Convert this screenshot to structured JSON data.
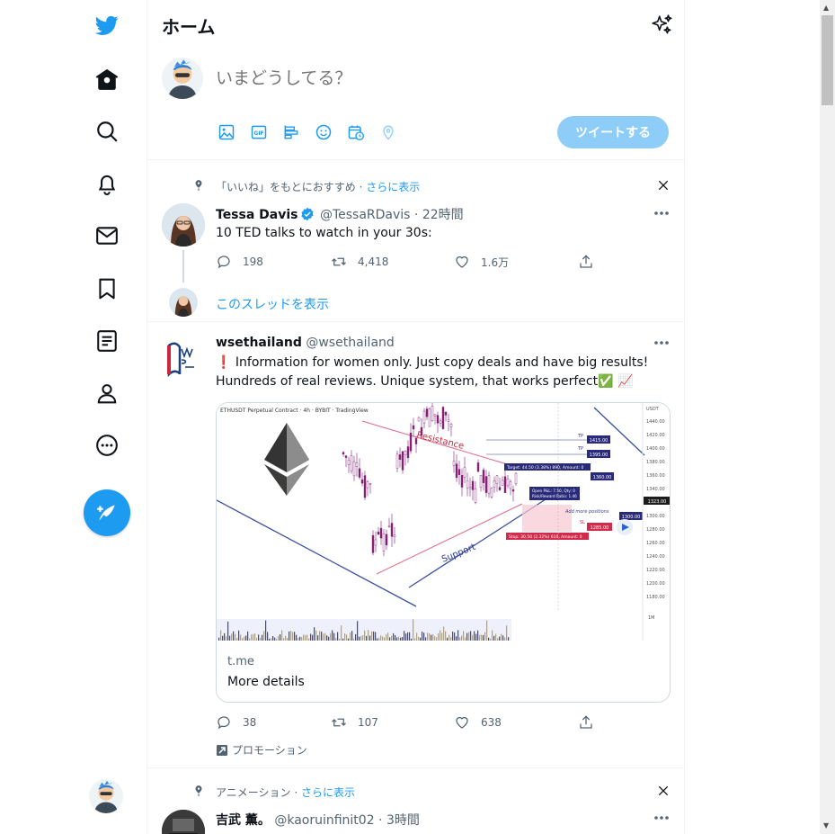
{
  "nav": {
    "icons": [
      "twitter-logo",
      "home-icon",
      "search-icon",
      "bell-icon",
      "mail-icon",
      "bookmark-icon",
      "list-icon",
      "profile-icon",
      "more-circle-icon"
    ],
    "compose_icon": "compose-icon"
  },
  "header": {
    "title": "ホーム",
    "icon": "sparkle-icon"
  },
  "composer": {
    "placeholder": "いまどうしてる？",
    "tools": [
      "image-icon",
      "gif-icon",
      "poll-icon",
      "emoji-icon",
      "schedule-icon",
      "location-icon"
    ],
    "submit_label": "ツイートする"
  },
  "feed": [
    {
      "context": "「いいね」をもとにおすすめ · ",
      "context_more": "さらに表示",
      "name": "Tessa Davis",
      "verified": true,
      "handle": "@TessaRDavis · 22時間",
      "text": "10 TED talks to watch in your 30s:",
      "replies": "198",
      "retweets": "4,418",
      "likes": "1.6万",
      "thread_link": "このスレッドを表示"
    },
    {
      "name": "wsethailand",
      "handle": "@wsethailand",
      "text_line1": "❗ Information for women only. Just copy deals and have big results!",
      "text_line2": "Hundreds of real reviews. Unique system, that works perfect✅ 📈",
      "card": {
        "chart_header": "ETHUSDT Perpetual Contract · 4h · BYBIT · TradingView",
        "resistance": "Resistance",
        "support": "Support",
        "add_positions": "Add more positions",
        "tp": "TP",
        "sl": "SL",
        "price_tags": [
          "1415.00",
          "1395.00",
          "1360.00",
          "1323.00",
          "1300.00",
          "1285.00"
        ],
        "target_label": "Target: 44.50 (3.38%) 890, Amount: 0",
        "open_pnl_label": "Open P&L: 7.50, Qty: 0",
        "risk_reward_label": "Risk/Reward Ratio: 1.46",
        "stop_label": "Stop: 30.50 (2.32%) 610, Amount: 0",
        "axis_ticks": [
          "1440.00",
          "1420.00",
          "1400.00",
          "1380.00",
          "1360.00",
          "1340.00",
          "1320.00",
          "1300.00",
          "1280.00",
          "1260.00",
          "1240.00",
          "1220.00",
          "1200.00",
          "1180.00"
        ],
        "axis_unit": "USDT",
        "volume_tick": "1M",
        "domain": "t.me",
        "title": "More details"
      },
      "replies": "38",
      "retweets": "107",
      "likes": "638",
      "promo": "プロモーション"
    },
    {
      "context": "アニメーション · ",
      "context_more": "さらに表示",
      "name": "吉武 薫。",
      "handle": "@kaoruinfinit02 · 3時間"
    }
  ]
}
